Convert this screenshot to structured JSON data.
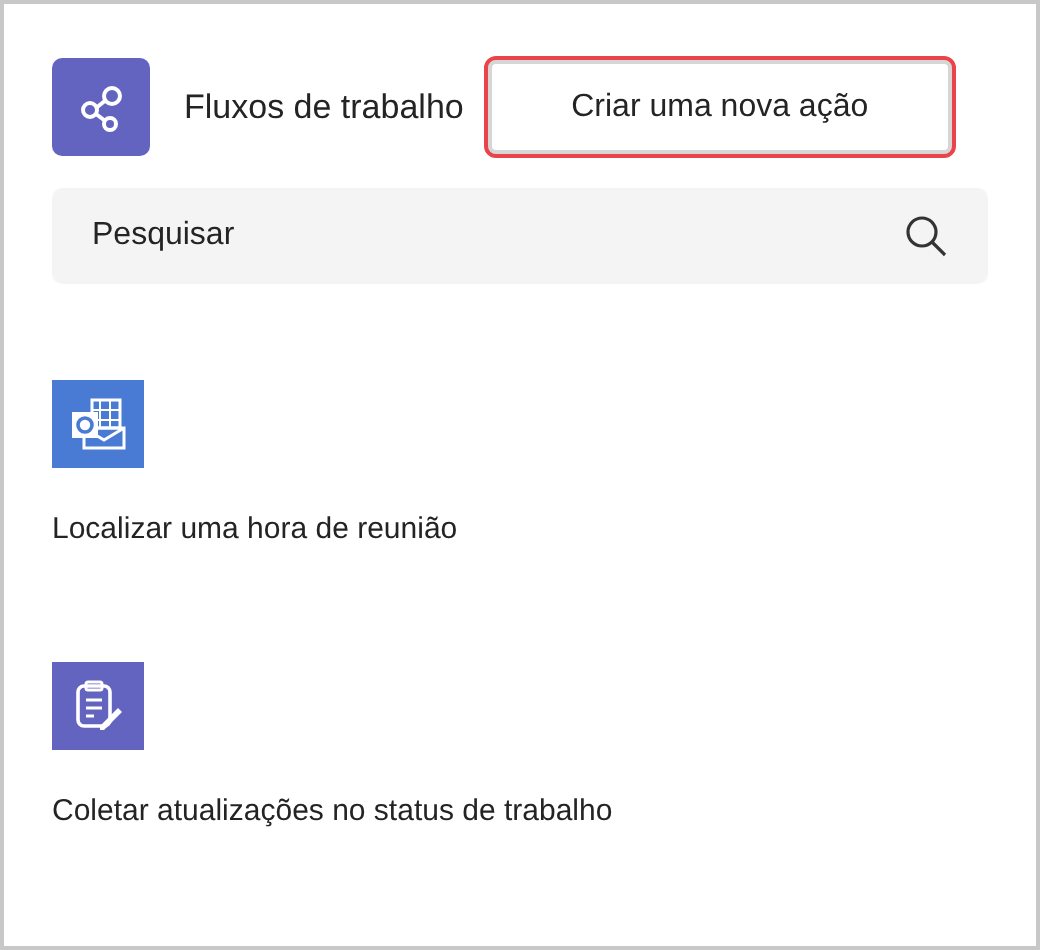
{
  "header": {
    "title": "Fluxos de trabalho",
    "button": {
      "label": "Criar uma nova ação",
      "highlighted": true
    }
  },
  "search": {
    "placeholder": "Pesquisar"
  },
  "templates": [
    {
      "kind": "calendar-mail",
      "color": "#4a7bd4",
      "label": "Localizar uma hora de reunião"
    },
    {
      "kind": "clipboard",
      "color": "#6264c0",
      "label": "Coletar atualizações no status de trabalho"
    }
  ]
}
